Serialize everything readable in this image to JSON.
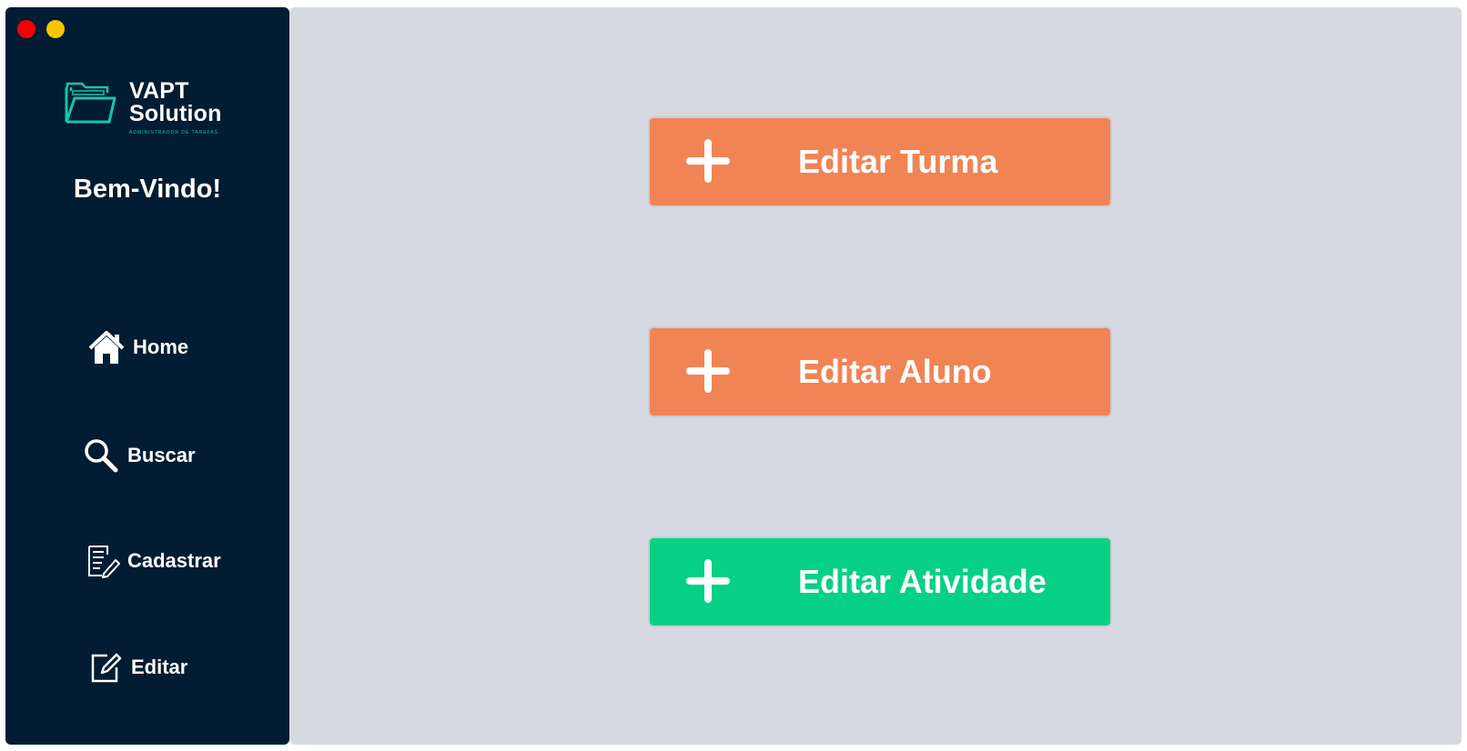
{
  "window": {
    "close_color": "#f40000",
    "minimize_color": "#f7c600"
  },
  "sidebar": {
    "background": "#021c33",
    "logo": {
      "line1": "VAPT",
      "line2": "Solution",
      "subtitle": "ADMINISTRADOR DE TAREFAS",
      "icon": "folder-icon",
      "accent": "#13c9a4"
    },
    "welcome": "Bem-Vindo!",
    "items": [
      {
        "label": "Home",
        "icon": "home-icon"
      },
      {
        "label": "Buscar",
        "icon": "search-icon"
      },
      {
        "label": "Cadastrar",
        "icon": "document-edit-icon"
      },
      {
        "label": "Editar",
        "icon": "edit-icon"
      }
    ]
  },
  "main": {
    "background": "#d7d9e0",
    "buttons": [
      {
        "label": "Editar Turma",
        "icon": "plus-icon",
        "color": "#f08455"
      },
      {
        "label": "Editar Aluno",
        "icon": "plus-icon",
        "color": "#f08455"
      },
      {
        "label": "Editar Atividade",
        "icon": "plus-icon",
        "color": "#06d184"
      }
    ]
  }
}
